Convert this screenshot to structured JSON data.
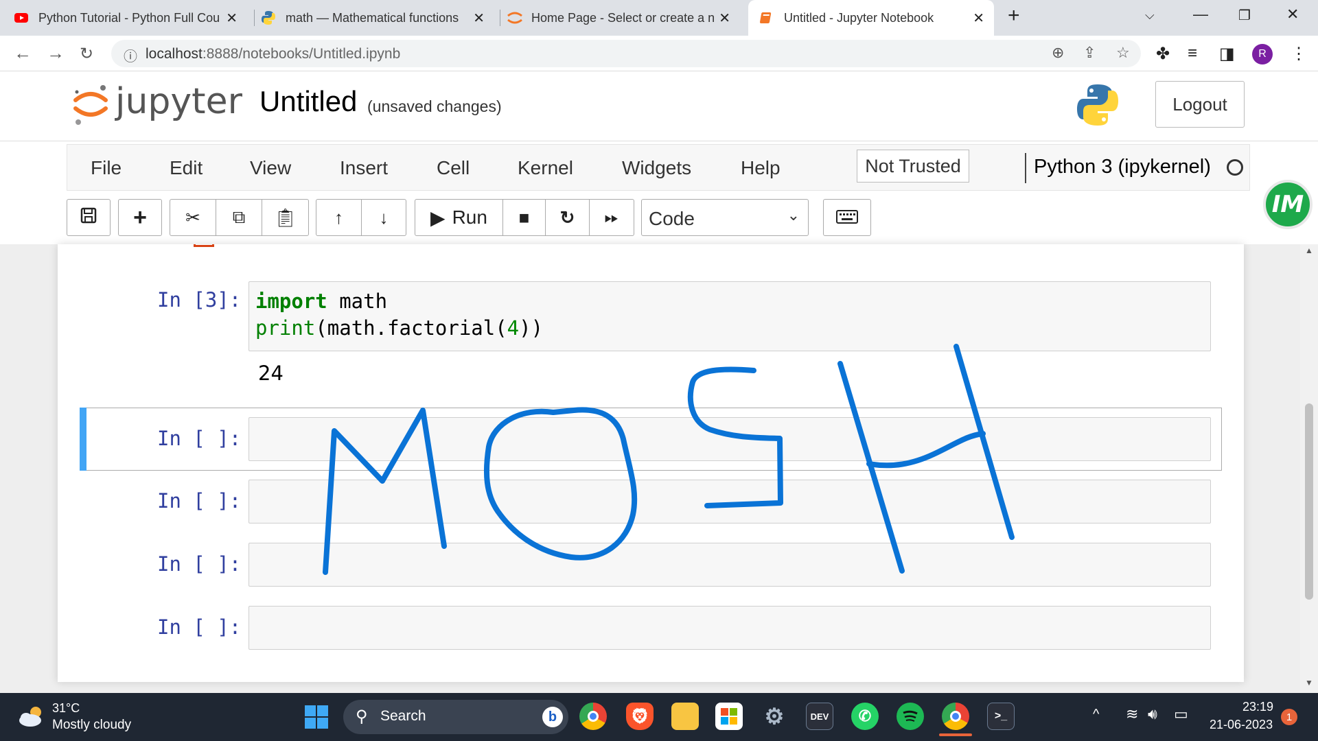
{
  "browser": {
    "tabs": [
      {
        "title": "Python Tutorial - Python Full Cou",
        "icon": "youtube-icon"
      },
      {
        "title": "math — Mathematical functions",
        "icon": "python-icon"
      },
      {
        "title": "Home Page - Select or create a n",
        "icon": "jupyter-icon"
      },
      {
        "title": "Untitled - Jupyter Notebook",
        "icon": "jupyter-notebook-icon",
        "active": true
      }
    ],
    "url_host": "localhost",
    "url_path": ":8888/notebooks/Untitled.ipynb",
    "profile_initial": "R"
  },
  "jupyter": {
    "logo_text": "jupyter",
    "notebook_name": "Untitled",
    "save_status": "(unsaved changes)",
    "logout_label": "Logout"
  },
  "menubar": {
    "items": [
      "File",
      "Edit",
      "View",
      "Insert",
      "Cell",
      "Kernel",
      "Widgets",
      "Help"
    ],
    "trust_label": "Not Trusted",
    "kernel_name": "Python 3 (ipykernel)"
  },
  "toolbar": {
    "run_label": "Run",
    "cell_type": "Code"
  },
  "extension_badge": "IM",
  "cells": [
    {
      "prompt": "In [3]:",
      "code_line1_kw": "import",
      "code_line1_rest": " math",
      "code_line2_fn": "print",
      "code_line2_a": "(math.factorial(",
      "code_line2_num": "4",
      "code_line2_b": "))",
      "output": "24"
    },
    {
      "prompt": "In [ ]:"
    },
    {
      "prompt": "In [ ]:"
    },
    {
      "prompt": "In [ ]:"
    },
    {
      "prompt": "In [ ]:"
    }
  ],
  "taskbar": {
    "temperature": "31°C",
    "weather": "Mostly cloudy",
    "search_label": "Search",
    "time": "23:19",
    "date": "21-06-2023",
    "notifications": "1"
  },
  "colors": {
    "jupyter_orange": "#f37726",
    "prompt_blue": "#303f9f",
    "keyword_green": "#008000",
    "selected_cell_bar": "#42a5f5",
    "ink_blue": "#0a73d6",
    "taskbar_bg": "#1f2733"
  }
}
